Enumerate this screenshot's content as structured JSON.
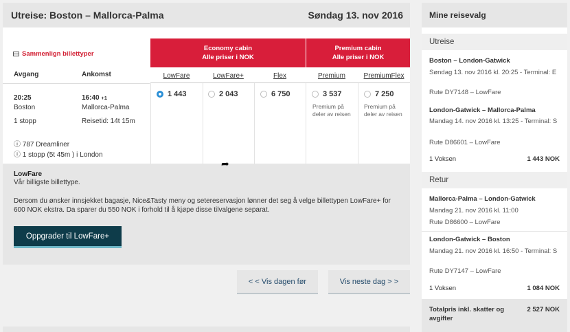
{
  "header": {
    "title": "Utreise:  Boston – Mallorca-Palma",
    "date": "Søndag 13. nov 2016"
  },
  "compare": {
    "label": "Sammenlign billettyper"
  },
  "columns": {
    "departure": "Avgang",
    "arrival": "Ankomst"
  },
  "flight": {
    "dep_time": "20:25",
    "dep_city": "Boston",
    "stops": "1 stopp",
    "arr_time": "16:40",
    "arr_plus": "+1",
    "arr_city": "Mallorca-Palma",
    "duration": "Reisetid: 14t 15m",
    "aircraft": "ⓘ 787 Dreamliner",
    "stop_detail": "ⓘ 1 stopp (5t 45m ) i London"
  },
  "cabins": [
    {
      "name": "Economy cabin",
      "sub": "Alle priser i NOK"
    },
    {
      "name": "Premium cabin",
      "sub": "Alle priser i NOK"
    }
  ],
  "fares": [
    {
      "name": "LowFare",
      "price": "1 443",
      "selected": true,
      "note": ""
    },
    {
      "name": "LowFare+",
      "price": "2 043",
      "selected": false,
      "note": ""
    },
    {
      "name": "Flex",
      "price": "6 750",
      "selected": false,
      "note": ""
    },
    {
      "name": "Premium",
      "price": "3 537",
      "selected": false,
      "note": "Premium på deler av reisen"
    },
    {
      "name": "PremiumFlex",
      "price": "7 250",
      "selected": false,
      "note": "Premium på deler av reisen"
    }
  ],
  "info": {
    "title": "LowFare",
    "subtitle": "Vår billigste billettype.",
    "body": "Dersom du ønsker innsjekket bagasje, Nice&Tasty meny og setereservasjon lønner det seg å velge billettypen LowFare+ for 600 NOK ekstra. Da sparer du 550 NOK i forhold til å kjøpe disse tilvalgene separat.",
    "button": "Oppgrader til LowFare+"
  },
  "nav": {
    "prev": "< < Vis dagen før",
    "next": "Vis neste dag > >"
  },
  "sidebar": {
    "title": "Mine reisevalg",
    "outbound_label": "Utreise",
    "outbound": [
      {
        "route": "Boston – London-Gatwick",
        "time": "Søndag 13. nov 2016 kl. 20:25 - Terminal: E",
        "flight": "Rute DY7148 – LowFare"
      },
      {
        "route": "London-Gatwick – Mallorca-Palma",
        "time": "Mandag 14. nov 2016 kl. 13:25 - Terminal: S",
        "flight": "Rute D86601 – LowFare"
      }
    ],
    "outbound_pax": "1 Voksen",
    "outbound_price": "1 443 NOK",
    "return_label": "Retur",
    "return": [
      {
        "route": "Mallorca-Palma – London-Gatwick",
        "time": "Mandag 21. nov 2016 kl. 11:00",
        "flight": "Rute D86600 – LowFare"
      },
      {
        "route": "London-Gatwick – Boston",
        "time": "Mandag 21. nov 2016 kl. 16:50 - Terminal: S",
        "flight": "Rute DY7147 – LowFare"
      }
    ],
    "return_pax": "1 Voksen",
    "return_price": "1 084 NOK",
    "total_label": "Totalpris inkl. skatter og avgifter",
    "total": "2 527 NOK"
  },
  "colors": {
    "accent": "#d81e3a",
    "button": "#0e3c4a",
    "radio": "#2a8fd6"
  }
}
